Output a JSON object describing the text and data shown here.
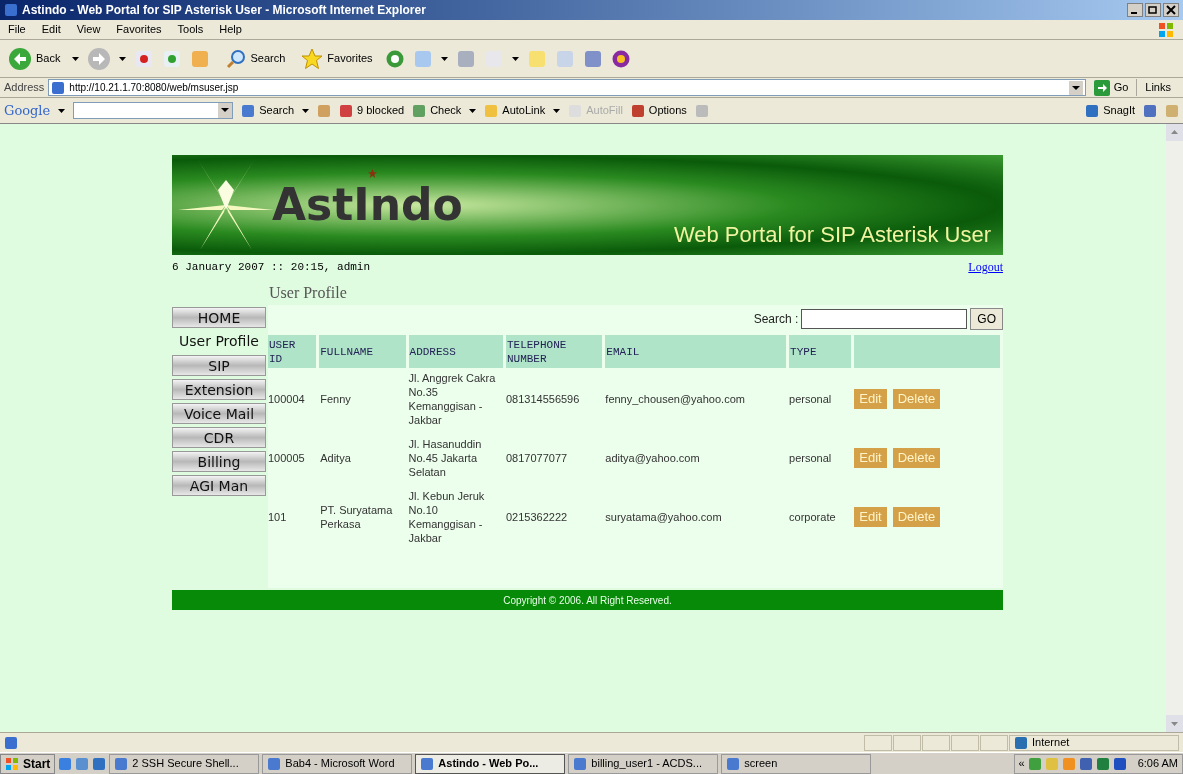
{
  "window": {
    "title": "Astindo - Web Portal for SIP Asterisk User - Microsoft Internet Explorer"
  },
  "menu": [
    "File",
    "Edit",
    "View",
    "Favorites",
    "Tools",
    "Help"
  ],
  "toolbar": {
    "back": "Back",
    "search": "Search",
    "favorites": "Favorites"
  },
  "address": {
    "label": "Address",
    "url": "http://10.21.1.70:8080/web/msuser.jsp",
    "go": "Go",
    "links": "Links"
  },
  "google_bar": {
    "logo": "Google",
    "search": "Search",
    "blocked": "9 blocked",
    "check": "Check",
    "autolink": "AutoLink",
    "autofill": "AutoFill",
    "autofill_disabled": true,
    "options": "Options",
    "snagit": "SnagIt"
  },
  "page": {
    "brand": "AstIndo",
    "tagline": "Web Portal for SIP Asterisk User",
    "session": "6 January 2007 :: 20:15, admin",
    "logout": "Logout",
    "heading": "User Profile",
    "nav": [
      {
        "label": "HOME",
        "selected": false
      },
      {
        "label": "User Profile",
        "selected": true
      },
      {
        "label": "SIP",
        "selected": false
      },
      {
        "label": "Extension",
        "selected": false
      },
      {
        "label": "Voice Mail",
        "selected": false
      },
      {
        "label": "CDR",
        "selected": false
      },
      {
        "label": "Billing",
        "selected": false
      },
      {
        "label": "AGI Man",
        "selected": false
      }
    ],
    "search_label": "Search :",
    "search_button": "GO",
    "table": {
      "columns": [
        "USER ID",
        "FULLNAME",
        "ADDRESS",
        "TELEPHONE NUMBER",
        "EMAIL",
        "TYPE"
      ],
      "rows": [
        {
          "cells": [
            "100004",
            "Fenny",
            "Jl. Anggrek Cakra No.35 Kemanggisan - Jakbar",
            "081314556596",
            "fenny_chousen@yahoo.com",
            "personal"
          ],
          "actions": [
            "Edit",
            "Delete"
          ]
        },
        {
          "cells": [
            "100005",
            "Aditya",
            "Jl. Hasanuddin No.45 Jakarta Selatan",
            "0817077077",
            "aditya@yahoo.com",
            "personal"
          ],
          "actions": [
            "Edit",
            "Delete"
          ]
        },
        {
          "cells": [
            "101",
            "PT. Suryatama Perkasa",
            "Jl. Kebun Jeruk No.10 Kemanggisan - Jakbar",
            "0215362222",
            "suryatama@yahoo.com",
            "corporate"
          ],
          "actions": [
            "Edit",
            "Delete"
          ]
        }
      ]
    },
    "footer": "Copyright © 2006. All Right Reserved."
  },
  "status_bar": {
    "zone": "Internet"
  },
  "taskbar": {
    "start": "Start",
    "tasks": [
      {
        "label": "2 SSH Secure Shell...",
        "selected": false
      },
      {
        "label": "Bab4 - Microsoft Word",
        "selected": false
      },
      {
        "label": "Astindo - Web Po...",
        "selected": true
      },
      {
        "label": "billing_user1 - ACDS...",
        "selected": false
      },
      {
        "label": "screen",
        "selected": false
      }
    ],
    "tray_expand": "«",
    "clock": "6:06 AM"
  }
}
